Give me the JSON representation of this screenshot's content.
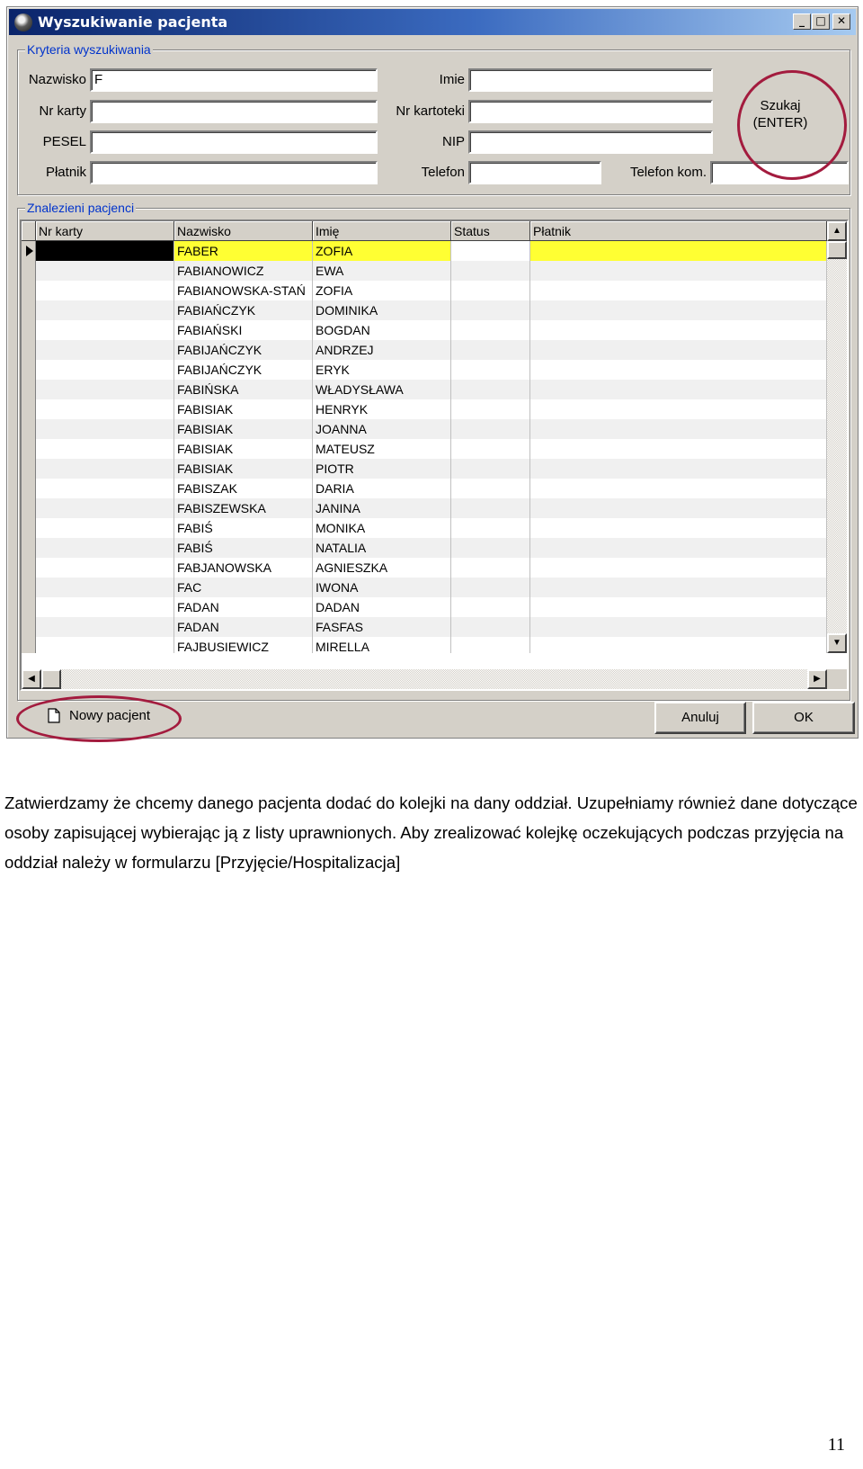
{
  "window": {
    "title": "Wyszukiwanie pacjenta",
    "minimize_glyph": "_",
    "maximize_glyph": "□",
    "close_glyph": "✕"
  },
  "criteria": {
    "legend": "Kryteria wyszukiwania",
    "nazwisko_label": "Nazwisko",
    "nazwisko_value": "F",
    "nr_karty_label": "Nr karty",
    "pesel_label": "PESEL",
    "platnik_label": "Płatnik",
    "imie_label": "Imie",
    "nr_kartoteki_label": "Nr kartoteki",
    "nip_label": "NIP",
    "telefon_label": "Telefon",
    "telefon_kom_label": "Telefon kom.",
    "search_button_line1": "Szukaj",
    "search_button_line2": "(ENTER)"
  },
  "results": {
    "legend": "Znalezieni pacjenci",
    "columns": [
      "Nr karty",
      "Nazwisko",
      "Imię",
      "Status",
      "Płatnik"
    ],
    "rows": [
      {
        "nazwisko": "FABER",
        "imie": "ZOFIA",
        "selected": true
      },
      {
        "nazwisko": "FABIANOWICZ",
        "imie": "EWA"
      },
      {
        "nazwisko": "FABIANOWSKA-STAŃ",
        "imie": "ZOFIA"
      },
      {
        "nazwisko": "FABIAŃCZYK",
        "imie": "DOMINIKA"
      },
      {
        "nazwisko": "FABIAŃSKI",
        "imie": "BOGDAN"
      },
      {
        "nazwisko": "FABIJAŃCZYK",
        "imie": "ANDRZEJ"
      },
      {
        "nazwisko": "FABIJAŃCZYK",
        "imie": "ERYK"
      },
      {
        "nazwisko": "FABIŃSKA",
        "imie": "WŁADYSŁAWA"
      },
      {
        "nazwisko": "FABISIAK",
        "imie": "HENRYK"
      },
      {
        "nazwisko": "FABISIAK",
        "imie": "JOANNA"
      },
      {
        "nazwisko": "FABISIAK",
        "imie": "MATEUSZ"
      },
      {
        "nazwisko": "FABISIAK",
        "imie": "PIOTR"
      },
      {
        "nazwisko": "FABISZAK",
        "imie": "DARIA"
      },
      {
        "nazwisko": "FABISZEWSKA",
        "imie": "JANINA"
      },
      {
        "nazwisko": "FABIŚ",
        "imie": "MONIKA"
      },
      {
        "nazwisko": "FABIŚ",
        "imie": "NATALIA"
      },
      {
        "nazwisko": "FABJANOWSKA",
        "imie": "AGNIESZKA"
      },
      {
        "nazwisko": "FAC",
        "imie": "IWONA"
      },
      {
        "nazwisko": "FADAN",
        "imie": "DADAN"
      },
      {
        "nazwisko": "FADAN",
        "imie": "FASFAS"
      },
      {
        "nazwisko": "FAJBUSIEWICZ",
        "imie": "MIRELLA"
      }
    ]
  },
  "footer": {
    "new_patient_label": "Nowy pacjent",
    "cancel_label": "Anuluj",
    "ok_label": "OK"
  },
  "colors": {
    "selected_row": "#ffff33",
    "highlight_ring": "#a31b3e",
    "title_bar": "#0a246a"
  },
  "document": {
    "paragraph": "Zatwierdzamy że chcemy danego pacjenta dodać do kolejki na dany oddział. Uzupełniamy również dane dotyczące osoby zapisującej wybierając ją z listy uprawnionych. Aby zrealizować kolejkę oczekujących podczas przyjęcia na oddział należy w formularzu [Przyjęcie/Hospitalizacja]",
    "page_number": "11"
  }
}
